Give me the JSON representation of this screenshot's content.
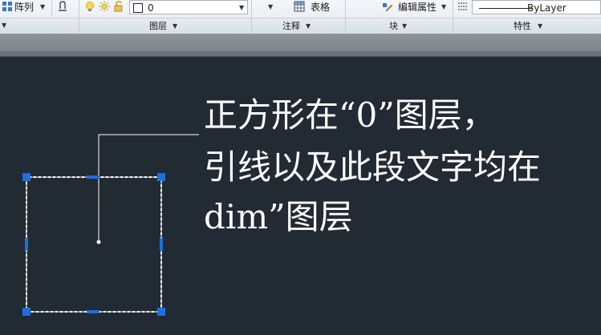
{
  "ribbon": {
    "array_label": "阵列",
    "layer_value": "0",
    "table_label": "表格",
    "edit_attr_label": "编辑属性",
    "linetype_value": "ByLayer"
  },
  "panels": {
    "layers": "图层",
    "annotation": "注释",
    "block": "块",
    "properties": "特性"
  },
  "drawing": {
    "text_line1": "正方形在“0”图层，",
    "text_line2": "引线以及此段文字均在",
    "text_line3": "dim”图层"
  },
  "colors": {
    "canvas_bg": "#222a33",
    "grip_blue": "#1e6fe0",
    "text_white": "#ffffff"
  },
  "icons": [
    "array-icon",
    "match-layer-icon",
    "bulb-icon",
    "sun-icon",
    "lock-icon",
    "layer-color-icon",
    "table-icon",
    "edit-attribute-icon",
    "linetype-icon"
  ]
}
